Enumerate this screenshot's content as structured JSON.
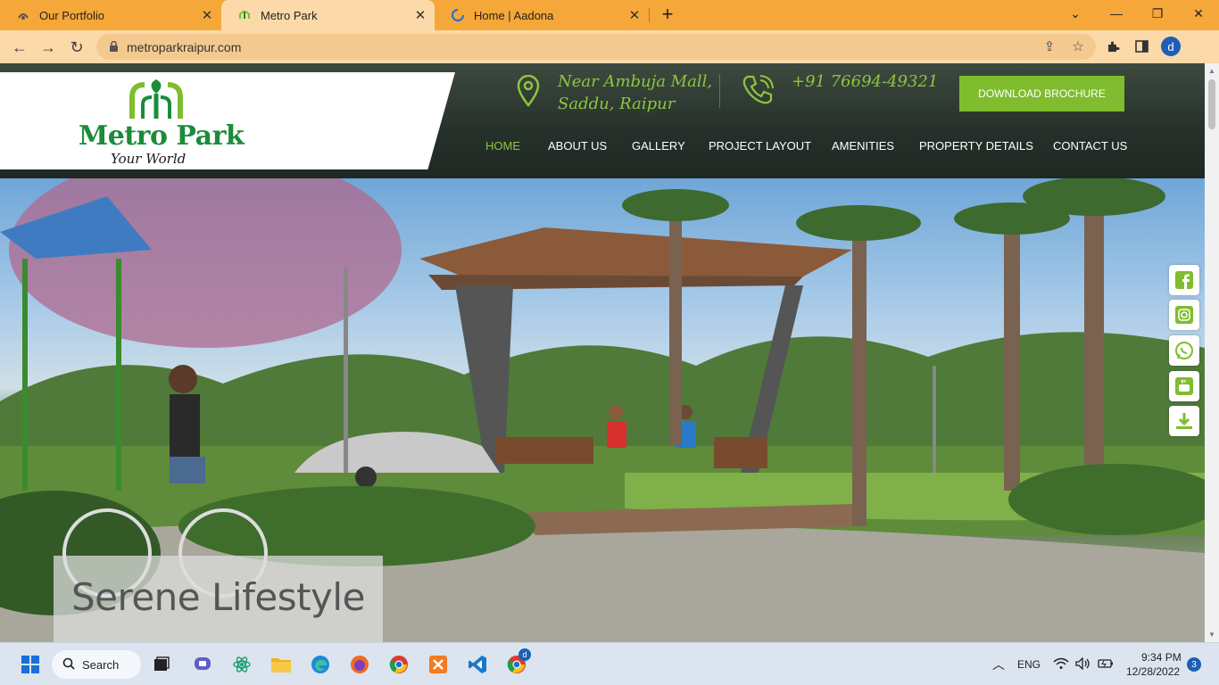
{
  "browser": {
    "tabs": [
      {
        "title": "Our Portfolio",
        "active": false
      },
      {
        "title": "Metro Park",
        "active": true
      },
      {
        "title": "Home | Aadona",
        "active": false
      }
    ],
    "url": "metroparkraipur.com"
  },
  "header": {
    "logo_name": "Metro Park",
    "logo_tagline": "Your World",
    "address_line1": "Near Ambuja Mall,",
    "address_line2": "Saddu, Raipur",
    "phone": "+91 76694-49321",
    "download_label": "DOWNLOAD BROCHURE"
  },
  "nav": [
    {
      "label": "HOME",
      "active": true
    },
    {
      "label": "ABOUT US",
      "active": false
    },
    {
      "label": "GALLERY",
      "active": false
    },
    {
      "label": "PROJECT LAYOUT",
      "active": false
    },
    {
      "label": "AMENITIES",
      "active": false
    },
    {
      "label": "PROPERTY DETAILS",
      "active": false
    },
    {
      "label": "CONTACT US",
      "active": false
    }
  ],
  "hero": {
    "caption": "Serene Lifestyle"
  },
  "social": [
    "facebook-icon",
    "instagram-icon",
    "whatsapp-icon",
    "youtube-icon",
    "download-icon"
  ],
  "taskbar": {
    "search_label": "Search",
    "lang": "ENG",
    "time": "9:34 PM",
    "date": "12/28/2022",
    "notifications": "3",
    "chrome_badge": "d"
  },
  "profile_initial": "d",
  "colors": {
    "tab_strip": "#f6a73a",
    "toolbar": "#fbd9a8",
    "brand_green": "#8dc63f",
    "button_green": "#7fbd2e",
    "logo_green": "#1a8c3a"
  }
}
